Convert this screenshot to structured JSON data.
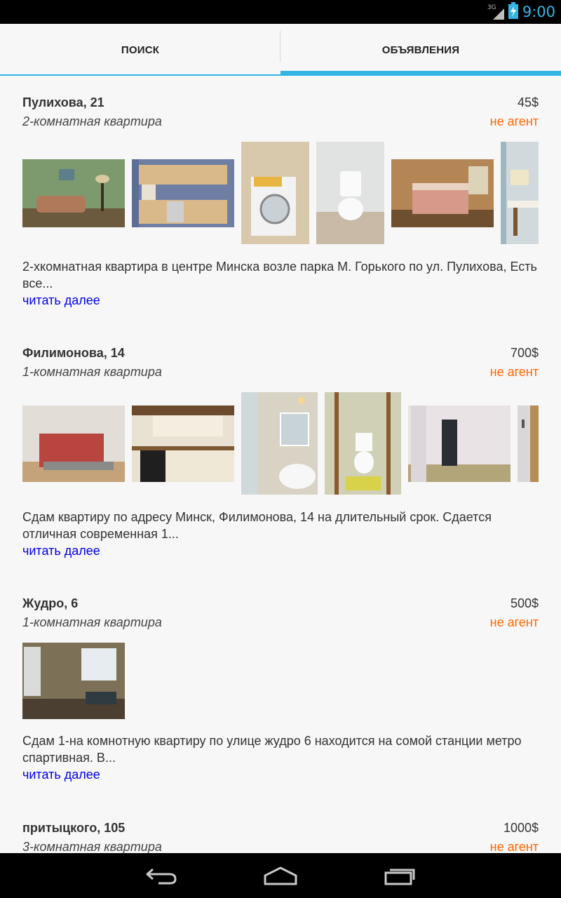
{
  "status_bar": {
    "network": "3G",
    "time": "9:00"
  },
  "tabs": [
    {
      "label": "ПОИСК",
      "selected": false
    },
    {
      "label": "ОБЪЯВЛЕНИЯ",
      "selected": true
    }
  ],
  "listings": [
    {
      "address": "Пулихова, 21",
      "price": "45$",
      "rooms": "2-комнатная квартира",
      "agent": "не агент",
      "description": "2-хкомнатная квартира в центре Минска возле парка М. Горького по ул. Пулихова, Есть все...",
      "more": "читать далее",
      "photos": [
        "living-room",
        "kitchen",
        "washing-machine",
        "toilet",
        "bedroom",
        "dining-area"
      ]
    },
    {
      "address": "Филимонова, 14",
      "price": "700$",
      "rooms": "1-комнатная квартира",
      "agent": "не агент",
      "description": "Сдам квартиру по адресу Минск, Филимонова, 14 на длительный срок. Сдается отличная современная 1...",
      "more": "читать далее",
      "photos": [
        "bedroom",
        "kitchen",
        "bathroom-sink",
        "toilet",
        "hallway",
        "door"
      ]
    },
    {
      "address": "Жудро, 6",
      "price": "500$",
      "rooms": "1-комнатная квартира",
      "agent": "не агент",
      "description": "Сдам 1-на комнотную квартиру по улице жудро 6 находится на сомой станции метро спартивная. В...",
      "more": "читать далее",
      "photos": [
        "room-with-window"
      ]
    },
    {
      "address": "притыцкого, 105",
      "price": "1000$",
      "rooms": "3-комнатная квартира",
      "agent": "не агент"
    }
  ],
  "colors": {
    "accent": "#33b5e5",
    "agent": "#ff6600",
    "link": "#0000ee",
    "background": "#f7f7f7"
  },
  "nav": {
    "icons": [
      "back-icon",
      "home-icon",
      "recent-apps-icon"
    ]
  }
}
